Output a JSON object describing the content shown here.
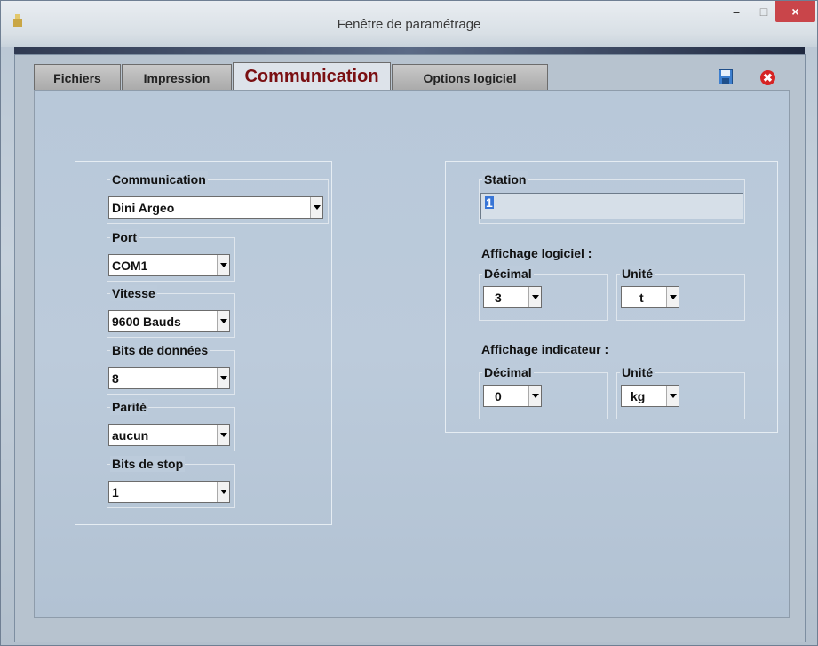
{
  "window": {
    "title": "Fenêtre de paramétrage",
    "minimize_glyph": "–",
    "maximize_glyph": "□",
    "close_glyph": "×"
  },
  "tabs": [
    {
      "label": "Fichiers"
    },
    {
      "label": "Impression"
    },
    {
      "label": "Communication",
      "active": true
    },
    {
      "label": "Options logiciel"
    }
  ],
  "toolbar": {
    "save_icon": "save-icon",
    "close_icon": "close-icon",
    "close_glyph": "✖"
  },
  "left_group": {
    "communication": {
      "label": "Communication",
      "value": "Dini Argeo"
    },
    "port": {
      "label": "Port",
      "value": "COM1"
    },
    "vitesse": {
      "label": "Vitesse",
      "value": "9600 Bauds"
    },
    "bits_donnees": {
      "label": "Bits de données",
      "value": "8"
    },
    "parite": {
      "label": "Parité",
      "value": "aucun"
    },
    "bits_stop": {
      "label": "Bits de stop",
      "value": "1"
    }
  },
  "right_group": {
    "station": {
      "label": "Station",
      "value": "1"
    },
    "affichage_logiciel": {
      "title": "Affichage logiciel :",
      "decimal": {
        "label": "Décimal",
        "value": "3"
      },
      "unite": {
        "label": "Unité",
        "value": "t"
      }
    },
    "affichage_indicateur": {
      "title": "Affichage indicateur :",
      "decimal": {
        "label": "Décimal",
        "value": "0"
      },
      "unite": {
        "label": "Unité",
        "value": "kg"
      }
    }
  },
  "colors": {
    "active_tab_text": "#7a0f12",
    "close_button": "#c9454a",
    "selection": "#3875d6"
  }
}
